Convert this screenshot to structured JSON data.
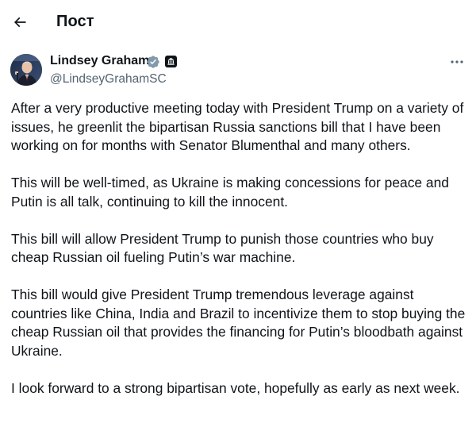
{
  "header": {
    "title": "Пост"
  },
  "author": {
    "name": "Lindsey Graham",
    "handle": "@LindseyGrahamSC"
  },
  "icons": {
    "back": "arrow-left-icon",
    "verified": "verified-badge-icon",
    "affiliation": "government-badge-icon",
    "more": "more-options-icon"
  },
  "colors": {
    "text": "#0f1419",
    "secondary": "#536471",
    "verified": "#829aab"
  },
  "tweet": {
    "paragraphs": [
      "After a very productive meeting today with President Trump on a variety of issues, he greenlit the bipartisan Russia sanctions bill that I have been working on for months with Senator Blumenthal and many others.",
      "This will be well-timed, as Ukraine is making concessions for peace and Putin is all talk, continuing to kill the innocent.",
      "This bill will allow President Trump to punish those countries who buy cheap Russian oil fueling Putin’s war machine.",
      "This bill would give President Trump tremendous leverage against countries like China, India and Brazil to incentivize them to stop buying the cheap Russian oil that provides the financing for Putin’s bloodbath against Ukraine.",
      "I look forward to a strong bipartisan vote, hopefully as early as next week."
    ]
  }
}
